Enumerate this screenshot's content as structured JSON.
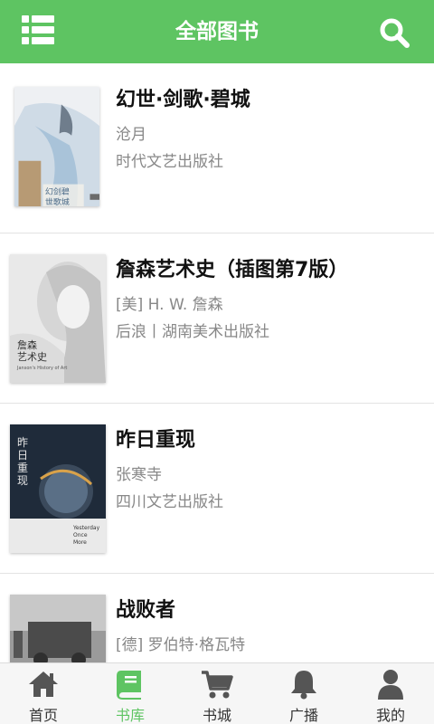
{
  "header": {
    "title": "全部图书",
    "menu_icon": "list-menu-icon",
    "search_icon": "search-icon",
    "accent_color": "#5ec462"
  },
  "books": [
    {
      "title": "幻世·剑歌·碧城",
      "author": "沧月",
      "publisher": "时代文艺出版社",
      "cover_text": "幻剑碧 世歌城"
    },
    {
      "title": "詹森艺术史（插图第7版）",
      "author": "[美] H. W. 詹森",
      "publisher": "后浪丨湖南美术出版社",
      "cover_text": "詹森 艺术史",
      "cover_subtext": "Janson's History of Art"
    },
    {
      "title": "昨日重现",
      "author": "张寒寺",
      "publisher": "四川文艺出版社",
      "cover_text": "昨日重现",
      "cover_subtext": "Yesterday Once More"
    },
    {
      "title": "战败者",
      "author": "[德] 罗伯特·格瓦特",
      "publisher": "",
      "cover_text": ""
    }
  ],
  "tabbar": {
    "active_color": "#5ec462",
    "items": [
      {
        "label": "首页",
        "icon": "home-icon",
        "active": false
      },
      {
        "label": "书库",
        "icon": "book-icon",
        "active": true
      },
      {
        "label": "书城",
        "icon": "cart-icon",
        "active": false
      },
      {
        "label": "广播",
        "icon": "bell-icon",
        "active": false
      },
      {
        "label": "我的",
        "icon": "user-icon",
        "active": false
      }
    ]
  }
}
